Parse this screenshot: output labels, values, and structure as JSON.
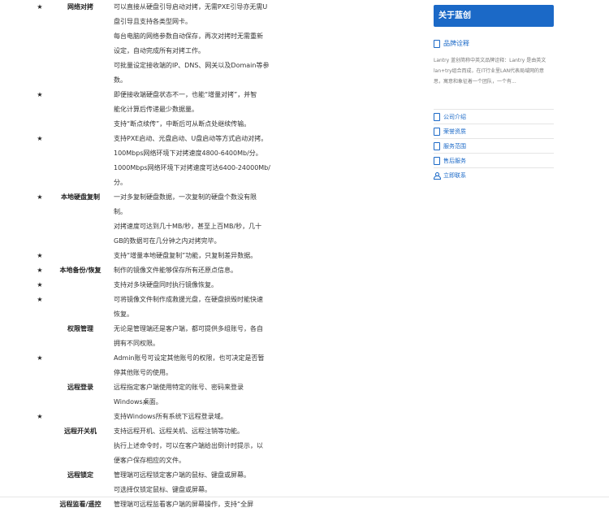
{
  "rows": [
    {
      "star": "★",
      "label": "网络对拷",
      "text": "可以直接从硬盘引导启动对拷，无需PXE引导亦无需U"
    },
    {
      "star": "",
      "label": "",
      "text": "盘引导且支持各类型网卡。"
    },
    {
      "star": "",
      "label": "",
      "text": "每台电脑的网络参数自动保存，再次对拷时无需重新"
    },
    {
      "star": "",
      "label": "",
      "text": "设定，自动完成所有对拷工作。"
    },
    {
      "star": "",
      "label": "",
      "text": "可批量设定接收端的IP、DNS、网关以及Domain等参"
    },
    {
      "star": "",
      "label": "",
      "text": "数。"
    },
    {
      "star": "★",
      "label": "",
      "text": "即便接收端硬盘状态不一，也能“增量对拷”，并智"
    },
    {
      "star": "",
      "label": "",
      "text": "能化计算后传递最少数据量。"
    },
    {
      "star": "",
      "label": "",
      "text": "支持“断点续传”，中断后可从断点处继续传输。"
    },
    {
      "star": "★",
      "label": "",
      "text": "支持PXE启动、光盘启动、U盘启动等方式启动对拷。"
    },
    {
      "star": "",
      "label": "",
      "text": "100Mbps网络环境下对拷速度4800-6400Mb/分。"
    },
    {
      "star": "",
      "label": "",
      "text": "1000Mbps网络环境下对拷速度可达6400-24000Mb/"
    },
    {
      "star": "",
      "label": "",
      "text": "分。"
    },
    {
      "star": "★",
      "label": "本地硬盘复制",
      "text": "一对多复制硬盘数据，一次复制的硬盘个数没有限"
    },
    {
      "star": "",
      "label": "",
      "text": "制。"
    },
    {
      "star": "",
      "label": "",
      "text": "对拷速度可达到几十MB/秒，甚至上百MB/秒，几十"
    },
    {
      "star": "",
      "label": "",
      "text": "GB的数据可在几分钟之内对拷完毕。"
    },
    {
      "star": "★",
      "label": "",
      "text": "支持“增量本地硬盘复制”功能，只复制差异数据。"
    },
    {
      "star": "★",
      "label": "本地备份/恢复",
      "text": "制作的镜像文件能够保存所有还原点信息。"
    },
    {
      "star": "★",
      "label": "",
      "text": "支持对多块硬盘同时执行镜像恢复。"
    },
    {
      "star": "★",
      "label": "",
      "text": "可将镜像文件制作成救援光盘，在硬盘损毁时能快速"
    },
    {
      "star": "",
      "label": "",
      "text": "恢复。"
    },
    {
      "star": "",
      "label": "权限管理",
      "text": "无论是管理端还是客户端，都可提供多组账号，各自"
    },
    {
      "star": "",
      "label": "",
      "text": "拥有不同权限。"
    },
    {
      "star": "★",
      "label": "",
      "text": "Admin账号可设定其他账号的权限，也可决定是否暂"
    },
    {
      "star": "",
      "label": "",
      "text": "停其他账号的使用。"
    },
    {
      "star": "",
      "label": "远程登录",
      "text": "远程指定客户端使用特定的账号、密码来登录"
    },
    {
      "star": "",
      "label": "",
      "text": "Windows桌面。"
    },
    {
      "star": "★",
      "label": "",
      "text": "支持Windows所有系统下远程登录域。"
    },
    {
      "star": "",
      "label": "远程开关机",
      "text": "支持远程开机、远程关机、远程注销等功能。"
    },
    {
      "star": "",
      "label": "",
      "text": "执行上述命令时，可以在客户端给出倒计时提示，以"
    },
    {
      "star": "",
      "label": "",
      "text": "便客户保存相应的文件。"
    },
    {
      "star": "",
      "label": "远程锁定",
      "text": "管理端可远程锁定客户端的鼠标、键盘或屏幕。"
    },
    {
      "star": "",
      "label": "",
      "text": "可选择仅锁定鼠标、键盘或屏幕。"
    },
    {
      "star": "",
      "label": "远程监看/遥控",
      "text": "管理端可远程监看客户端的屏幕操作，支持“全屏"
    }
  ],
  "sidebar": {
    "about": "关于蓝创",
    "brand_title": "品牌诠释",
    "brand_desc": "Lantry 蓝创简称中英文品牌诠释：Lantry 是由英文lan+try组合而成，在IT行业里LAN代表局域网的意思，寓意和象征着一个团队，一个有...",
    "links": [
      "公司介绍",
      "荣誉资质",
      "服务范围",
      "售后服务",
      "立即联系"
    ]
  }
}
